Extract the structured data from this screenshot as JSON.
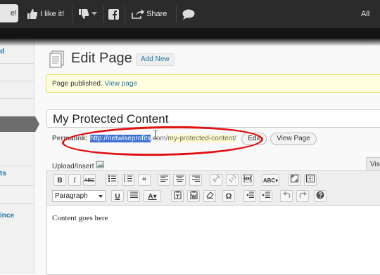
{
  "topbar": {
    "left_btn": "e!",
    "like": "I like it!",
    "share": "Share",
    "right": "All Int"
  },
  "sidebar": {
    "items": [
      "d",
      "ts",
      "ince"
    ]
  },
  "header": {
    "title": "Edit Page",
    "add_new": "Add New"
  },
  "notice": {
    "text": "Page published.",
    "link": "View page"
  },
  "post": {
    "title": "My Protected Content",
    "permalink_label": "Permalink:",
    "permalink_base": "http://netwiseprofits",
    "permalink_domain_end": ".com/",
    "permalink_slug": "my-protected-content",
    "permalink_trailing": "/",
    "edit_btn": "Edit",
    "view_btn": "View Page"
  },
  "editor": {
    "upload_label": "Upload/Insert",
    "visual_tab": "Visu",
    "format_select": "Paragraph",
    "content": "Content goes here"
  },
  "colors": {
    "oval": "#e01010",
    "selection": "#3b6fd1",
    "link": "#21759b"
  }
}
